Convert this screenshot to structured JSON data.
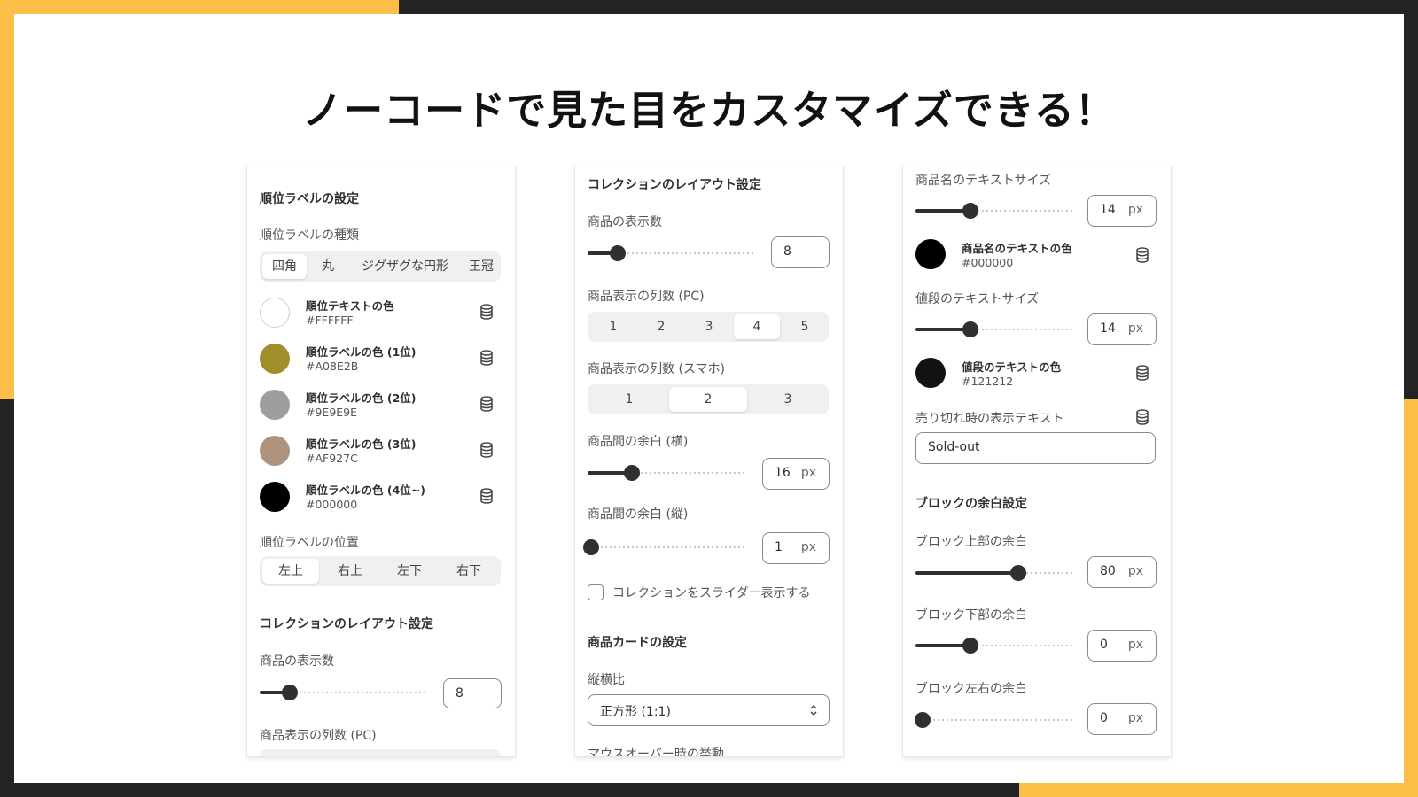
{
  "colors": {
    "frame": "#232323",
    "accent": "#FBBF47",
    "panel": "#FFFFFF"
  },
  "title": "ノーコードで見た目をカスタマイズできる！",
  "panel1": {
    "heading": "順位ラベルの設定",
    "type_label": "順位ラベルの種類",
    "type_options": [
      "四角",
      "丸",
      "ジグザグな円形",
      "王冠"
    ],
    "type_selected": "四角",
    "colors": [
      {
        "name": "順位テキストの色",
        "hex": "#FFFFFF",
        "icon": "database-icon"
      },
      {
        "name": "順位ラベルの色 (1位)",
        "hex": "#A08E2B",
        "icon": "database-icon"
      },
      {
        "name": "順位ラベルの色 (2位)",
        "hex": "#9E9E9E",
        "icon": "database-icon"
      },
      {
        "name": "順位ラベルの色 (3位)",
        "hex": "#AF927C",
        "icon": "database-icon"
      },
      {
        "name": "順位ラベルの色 (4位~)",
        "hex": "#000000",
        "icon": "database-icon"
      }
    ],
    "position_label": "順位ラベルの位置",
    "position_options": [
      "左上",
      "右上",
      "左下",
      "右下"
    ],
    "position_selected": "左上",
    "layout_heading": "コレクションのレイアウト設定",
    "count_label": "商品の表示数",
    "count_value": "8",
    "count_slider": 0.18,
    "cols_pc_label": "商品表示の列数 (PC)"
  },
  "panel2": {
    "heading": "コレクションのレイアウト設定",
    "count_label": "商品の表示数",
    "count_value": "8",
    "count_slider": 0.18,
    "cols_pc_label": "商品表示の列数 (PC)",
    "cols_pc_options": [
      "1",
      "2",
      "3",
      "4",
      "5"
    ],
    "cols_pc_selected": "4",
    "cols_sp_label": "商品表示の列数 (スマホ)",
    "cols_sp_options": [
      "1",
      "2",
      "3"
    ],
    "cols_sp_selected": "2",
    "gap_h_label": "商品間の余白 (横)",
    "gap_h_value": "16",
    "gap_h_slider": 0.28,
    "gap_v_label": "商品間の余白 (縦)",
    "gap_v_value": "1",
    "gap_v_slider": 0.02,
    "unit": "px",
    "slider_checkbox_label": "コレクションをスライダー表示する",
    "card_heading": "商品カードの設定",
    "aspect_label": "縦横比",
    "aspect_value": "正方形 (1:1)",
    "hover_label": "マウスオーバー時の挙動"
  },
  "panel3": {
    "name_size_label": "商品名のテキストサイズ",
    "name_size_value": "14",
    "name_size_slider": 0.35,
    "name_color_name": "商品名のテキストの色",
    "name_color_hex": "#000000",
    "price_size_label": "値段のテキストサイズ",
    "price_size_value": "14",
    "price_size_slider": 0.35,
    "price_color_name": "値段のテキストの色",
    "price_color_hex": "#121212",
    "soldout_label": "売り切れ時の表示テキスト",
    "soldout_value": "Sold-out",
    "block_heading": "ブロックの余白設定",
    "top_label": "ブロック上部の余白",
    "top_value": "80",
    "top_slider": 0.65,
    "bottom_label": "ブロック下部の余白",
    "bottom_value": "0",
    "bottom_slider": 0.35,
    "side_label": "ブロック左右の余白",
    "side_value": "0",
    "side_slider": 0.0,
    "unit": "px"
  }
}
